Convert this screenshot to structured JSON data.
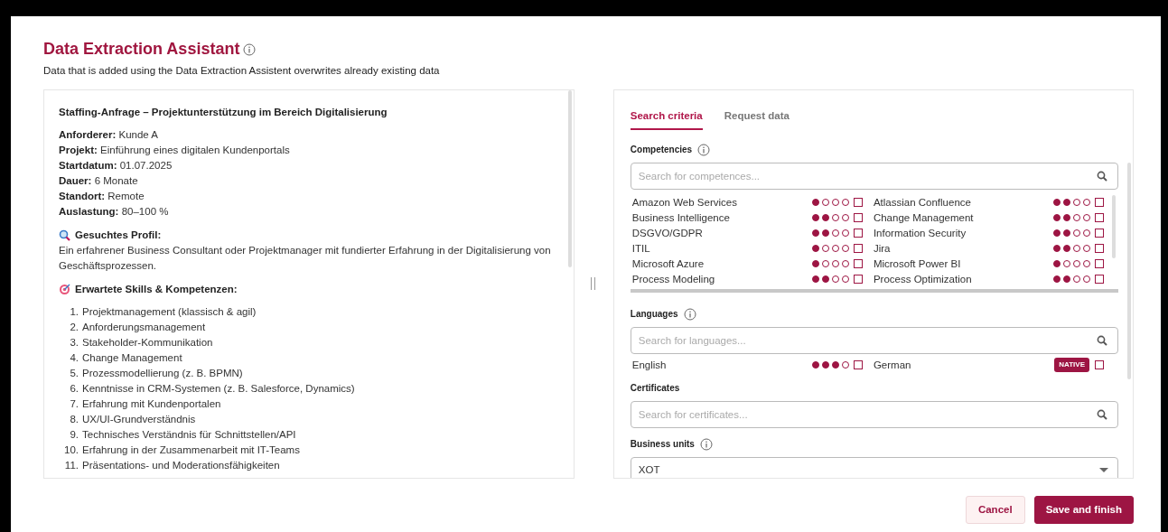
{
  "dialog": {
    "title": "Data Extraction Assistant",
    "subtitle": "Data that is added using the Data Extraction Assistent overwrites already existing data"
  },
  "request": {
    "title": "Staffing-Anfrage – Projektunterstützung im Bereich Digitalisierung",
    "fields": [
      {
        "label": "Anforderer:",
        "value": "Kunde A"
      },
      {
        "label": "Projekt:",
        "value": "Einführung eines digitalen Kundenportals"
      },
      {
        "label": "Startdatum:",
        "value": "01.07.2025"
      },
      {
        "label": "Dauer:",
        "value": "6 Monate"
      },
      {
        "label": "Standort:",
        "value": "Remote"
      },
      {
        "label": "Auslastung:",
        "value": "80–100 %"
      }
    ],
    "sections": [
      {
        "kind": "profile",
        "heading": "Gesuchtes Profil:",
        "text": "Ein erfahrener Business Consultant oder Projektmanager mit fundierter Erfahrung in der Digitalisierung von Geschäftsprozessen."
      },
      {
        "kind": "skills",
        "heading": "Erwartete Skills & Kompetenzen:",
        "items": [
          {
            "number": "1.",
            "text": "Projektmanagement (klassisch & agil)"
          },
          {
            "number": "2.",
            "text": "Anforderungsmanagement"
          },
          {
            "number": "3.",
            "text": "Stakeholder-Kommunikation"
          },
          {
            "number": "4.",
            "text": "Change Management"
          },
          {
            "number": "5.",
            "text": "Prozessmodellierung (z. B. BPMN)"
          },
          {
            "number": "6.",
            "text": "Kenntnisse in CRM-Systemen (z. B. Salesforce, Dynamics)"
          },
          {
            "number": "7.",
            "text": "Erfahrung mit Kundenportalen"
          },
          {
            "number": "8.",
            "text": "UX/UI-Grundverständnis"
          },
          {
            "number": "9.",
            "text": "Technisches Verständnis für Schnittstellen/API"
          },
          {
            "number": "10.",
            "text": "Erfahrung in der Zusammenarbeit mit IT-Teams"
          },
          {
            "number": "11.",
            "text": "Präsentations- und Moderationsfähigkeiten"
          }
        ]
      }
    ]
  },
  "tabs": [
    {
      "label": "Search criteria",
      "selected": true
    },
    {
      "label": "Request data",
      "selected": false
    }
  ],
  "competencies": {
    "label": "Competencies",
    "info": true,
    "placeholder": "Search for competences...",
    "items": [
      {
        "name": "Amazon Web Services",
        "stars": 1,
        "checked": false
      },
      {
        "name": "Atlassian Confluence",
        "stars": 2,
        "checked": false
      },
      {
        "name": "Business Intelligence",
        "stars": 2,
        "checked": false
      },
      {
        "name": "Change Management",
        "stars": 2,
        "checked": false
      },
      {
        "name": "DSGVO/GDPR",
        "stars": 2,
        "checked": false
      },
      {
        "name": "Information Security",
        "stars": 2,
        "checked": false
      },
      {
        "name": "ITIL",
        "stars": 1,
        "checked": false
      },
      {
        "name": "Jira",
        "stars": 2,
        "checked": false
      },
      {
        "name": "Microsoft Azure",
        "stars": 1,
        "checked": false
      },
      {
        "name": "Microsoft Power BI",
        "stars": 1,
        "checked": false
      },
      {
        "name": "Process Modeling",
        "stars": 2,
        "checked": false
      },
      {
        "name": "Process Optimization",
        "stars": 2,
        "checked": false
      }
    ]
  },
  "languages": {
    "label": "Languages",
    "info": true,
    "placeholder": "Search for languages...",
    "items": [
      {
        "name": "English",
        "kind": "rated",
        "stars": 3,
        "checked": false
      },
      {
        "name": "German",
        "kind": "native",
        "badge": "NATIVE",
        "checked": false
      }
    ]
  },
  "certificates": {
    "label": "Certificates",
    "info": false,
    "placeholder": "Search for certificates..."
  },
  "business_units": {
    "label": "Business units",
    "info": true,
    "value": "XOT"
  },
  "buttons": [
    {
      "label": "Cancel",
      "kind": "secondary"
    },
    {
      "label": "Save and finish",
      "kind": "primary"
    }
  ]
}
